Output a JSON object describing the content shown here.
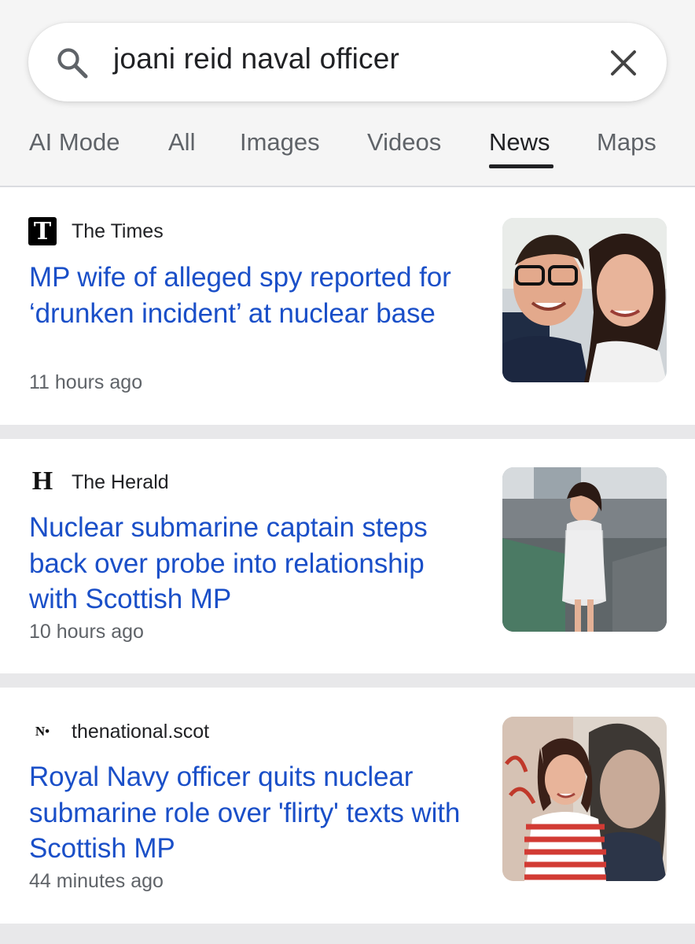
{
  "search": {
    "query": "joani reid naval officer",
    "search_icon": "search-icon",
    "clear_icon": "close-icon"
  },
  "tabs": [
    {
      "label": "AI Mode",
      "active": false
    },
    {
      "label": "All",
      "active": false
    },
    {
      "label": "Images",
      "active": false
    },
    {
      "label": "Videos",
      "active": false
    },
    {
      "label": "News",
      "active": true
    },
    {
      "label": "Maps",
      "active": false
    }
  ],
  "results": [
    {
      "source_logo": "T",
      "source": "The Times",
      "headline": "MP wife of alleged spy reported for ‘drunken incident’ at nuclear base",
      "time": "11 hours ago"
    },
    {
      "source_logo": "H",
      "source": "The Herald",
      "headline": "Nuclear submarine captain steps back over probe into relationship with Scottish MP",
      "time": "10 hours ago"
    },
    {
      "source_logo": "N•",
      "source": "thenational.scot",
      "headline": "Royal Navy officer quits nuclear submarine role over 'flirty' texts with Scottish MP",
      "time": "44 minutes ago"
    }
  ],
  "colors": {
    "link": "#1a4fc8",
    "meta": "#5f6368",
    "separator": "#e8e8ea"
  }
}
